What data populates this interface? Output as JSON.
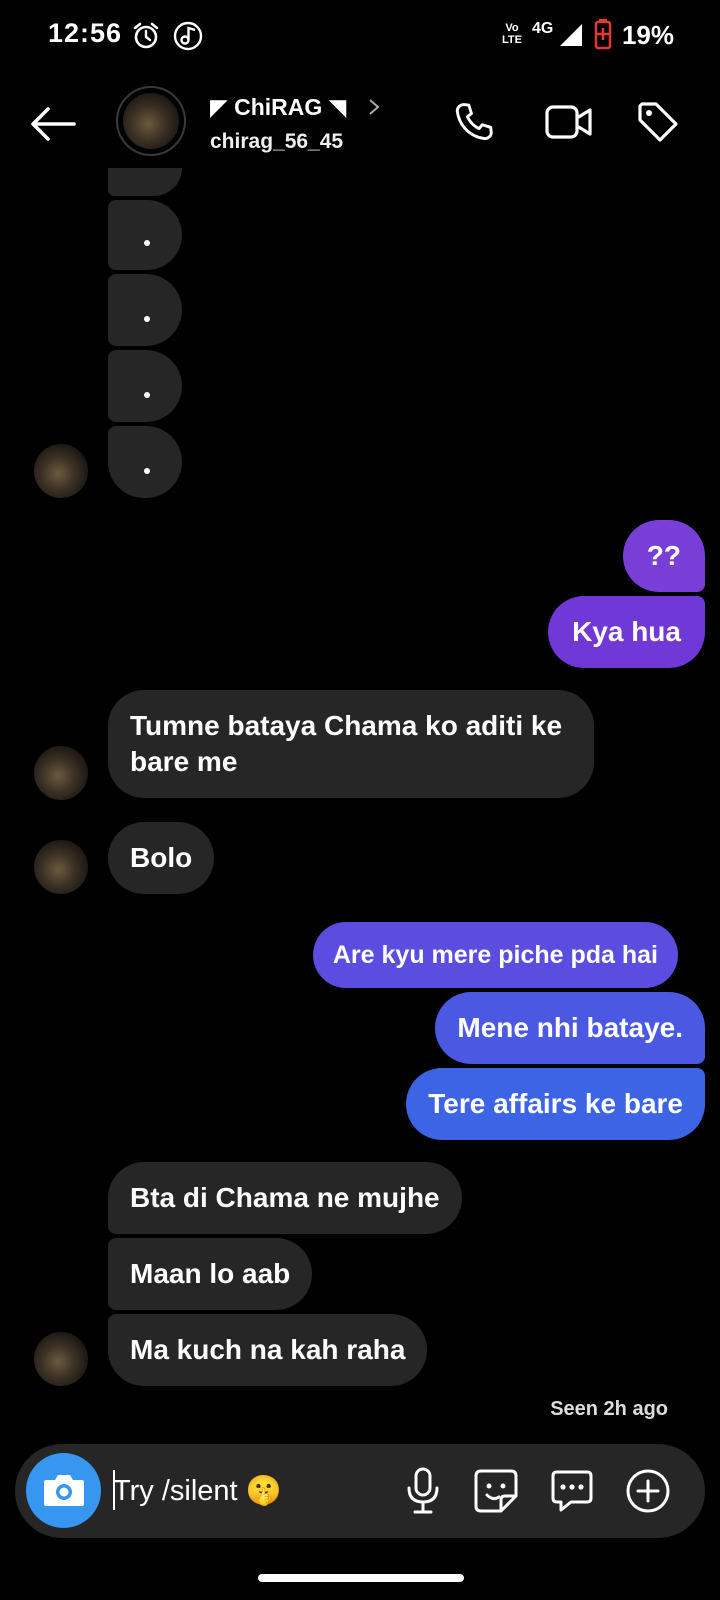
{
  "status_bar": {
    "time": "12:56",
    "network": "4G",
    "volte": "Vo LTE",
    "battery": "19%"
  },
  "header": {
    "name": "ChiRAG",
    "name_prefix": "◤",
    "name_suffix": "◥",
    "username": "chirag_56_45",
    "icons": [
      "back-arrow-icon",
      "phone-icon",
      "video-camera-icon",
      "tag-icon"
    ]
  },
  "messages": {
    "recv_dots": [
      ".",
      ".",
      ".",
      "."
    ],
    "m1": "??",
    "m2": "Kya hua",
    "m3": "Tumne bataya Chama ko aditi ke bare me",
    "m4": "Bolo",
    "m5": "Are kyu mere piche pda hai",
    "m6": "Mene nhi bataye.",
    "m7": "Tere affairs ke bare",
    "m8": "Bta di Chama ne mujhe",
    "m9": "Maan lo aab",
    "m10": "Ma kuch na kah raha"
  },
  "seen_text": "Seen 2h ago",
  "composer": {
    "input_text": "Try /silent 🤫",
    "icons": [
      "camera-icon",
      "microphone-icon",
      "sticker-icon",
      "message-options-icon",
      "add-icon"
    ]
  },
  "colors": {
    "received_bubble": "#262626",
    "sent_purple": "#7a3ed8",
    "sent_indigo": "#5b4de0",
    "sent_blue": "#3d64e5",
    "camera_button": "#3797f0"
  }
}
